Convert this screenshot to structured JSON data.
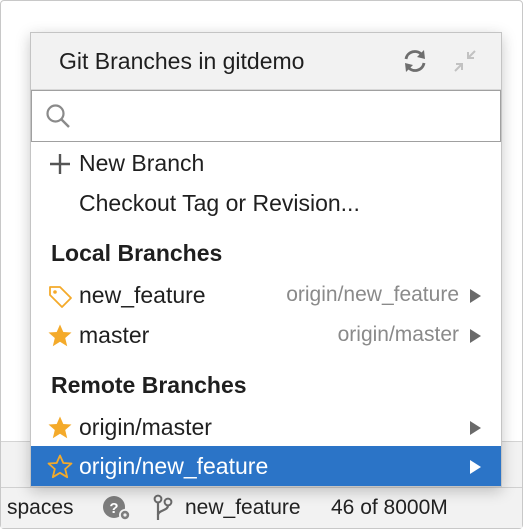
{
  "popup": {
    "title": "Git Branches in gitdemo",
    "header_icons": [
      "refresh-icon",
      "collapse-icon"
    ],
    "search": {
      "placeholder": "",
      "value": ""
    }
  },
  "actions": [
    {
      "icon": "plus-icon",
      "label": "New Branch"
    },
    {
      "icon": "",
      "label": "Checkout Tag or Revision..."
    }
  ],
  "local_branches": {
    "heading": "Local Branches",
    "items": [
      {
        "icon": "tag-icon",
        "label": "new_feature",
        "remote": "origin/new_feature"
      },
      {
        "icon": "star-filled-icon",
        "label": "master",
        "remote": "origin/master"
      }
    ]
  },
  "remote_branches": {
    "heading": "Remote Branches",
    "items": [
      {
        "icon": "star-filled-icon",
        "label": "origin/master",
        "selected": false
      },
      {
        "icon": "star-outline-icon",
        "label": "origin/new_feature",
        "selected": true
      }
    ]
  },
  "statusbar": {
    "indent": "spaces",
    "branch": "new_feature",
    "memory": "46 of 8000M"
  },
  "colors": {
    "selection": "#2b74c7",
    "star": "#f4aa2a",
    "tag": "#f4aa2a"
  }
}
